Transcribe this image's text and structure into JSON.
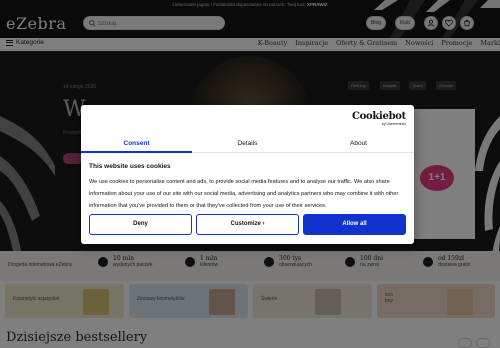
{
  "promo": {
    "text": "Liebesraten jagato / #ostatnidni dopasowane do potrzeb. Twoj kod: ",
    "code": "XPRAWIZ"
  },
  "header": {
    "logo": "eZebra",
    "search_placeholder": "Szukaj",
    "blog_label": "Blog",
    "klub_label": "Klub"
  },
  "nav": {
    "categories_label": "Kategorie",
    "links": [
      "K-Beauty",
      "Inspiracje",
      "Oferty & Gratisem",
      "Nowości",
      "Promocje",
      "Marki"
    ]
  },
  "hero": {
    "date": "14 lutego 2026",
    "title": "W",
    "subtitle": "Przygotuj",
    "tags": [
      "Perfumy",
      "Makijaż",
      "Twarz",
      "Zdrowie"
    ],
    "badge": "1+1"
  },
  "usp": {
    "shop_label": "Drogeria internetowa eZebra",
    "items": [
      {
        "main": "10 mln",
        "sub": "wydanych paczek"
      },
      {
        "main": "1 mln",
        "sub": "klientów"
      },
      {
        "main": "300 tys",
        "sub": "obserwujących"
      },
      {
        "main": "100 dni",
        "sub": "na zwrot"
      },
      {
        "main": "od 159zł",
        "sub": "dostawa gratis"
      }
    ]
  },
  "categories": [
    {
      "label": "Kosmetyki azjatyckie"
    },
    {
      "label": "Zestawy kosmetyków"
    },
    {
      "label": "Świece"
    },
    {
      "label": "eco\nbuy"
    }
  ],
  "bestsellers": {
    "title": "Dzisiejsze bestsellery"
  },
  "cookie_modal": {
    "logo_main": "Cookiebot",
    "logo_sub": "by Usercentrics",
    "tabs": [
      "Consent",
      "Details",
      "About"
    ],
    "active_tab": "Consent",
    "heading": "This website uses cookies",
    "body": "We use cookies to personalise content and ads, to provide social media features and to analyse our traffic. We also share information about your use of our site with our social media, advertising and analytics partners who may combine it with other information that you've provided to them or that they've collected from your use of their services.",
    "buttons": {
      "deny": "Deny",
      "customize": "Customize",
      "customize_arrow": "›",
      "allow_all": "Allow all"
    },
    "colors": {
      "accent": "#1032cf"
    }
  }
}
